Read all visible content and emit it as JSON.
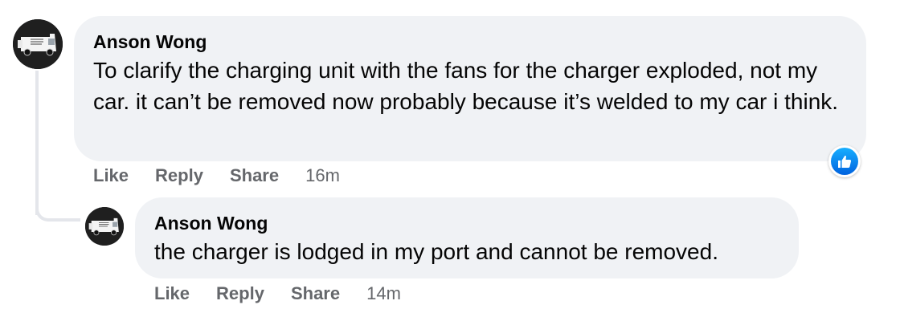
{
  "comments": [
    {
      "author": "Anson Wong",
      "text": "To clarify the charging unit with the fans for the charger exploded, not my car. it can’t be removed now probably because it’s welded to my car i think.",
      "actions": {
        "like": "Like",
        "reply": "Reply",
        "share": "Share"
      },
      "timestamp": "16m",
      "reaction": "like-icon"
    }
  ],
  "reply": {
    "author": "Anson Wong",
    "text": "the charger is lodged in my port and cannot be removed.",
    "actions": {
      "like": "Like",
      "reply": "Reply",
      "share": "Share"
    },
    "timestamp": "14m"
  },
  "colors": {
    "bubble": "#f0f2f5",
    "secondary_text": "#65676b",
    "like_blue": "#0866ff"
  }
}
